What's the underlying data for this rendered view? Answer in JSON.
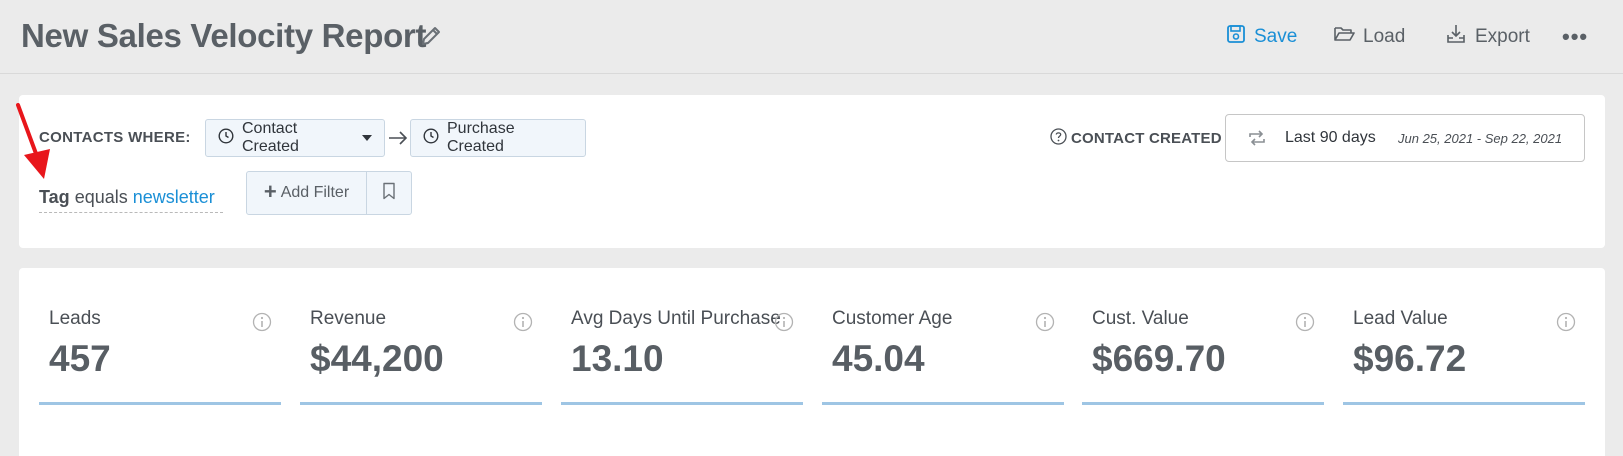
{
  "header": {
    "title": "New Sales Velocity Report",
    "save_label": "Save",
    "load_label": "Load",
    "export_label": "Export",
    "more_label": "•••"
  },
  "filters": {
    "contacts_where_label": "CONTACTS WHERE:",
    "step1_label": "Contact Created",
    "step2_label": "Purchase Created",
    "date_field_label": "CONTACT CREATED",
    "date_range_label": "Last 90 days",
    "date_range_dates": "Jun 25, 2021 - Sep 22, 2021",
    "tag_filter": {
      "key": "Tag",
      "operator": "equals",
      "value": "newsletter"
    },
    "add_filter_label": "Add Filter"
  },
  "metrics": [
    {
      "label": "Leads",
      "value": "457"
    },
    {
      "label": "Revenue",
      "value": "$44,200"
    },
    {
      "label": "Avg Days Until Purchase",
      "value": "13.10"
    },
    {
      "label": "Customer Age",
      "value": "45.04"
    },
    {
      "label": "Cust. Value",
      "value": "$669.70"
    },
    {
      "label": "Lead Value",
      "value": "$96.72"
    }
  ],
  "colors": {
    "accent": "#1a8fd6",
    "metric_underline": "#9ec5e4",
    "annotation_arrow": "#e8161b"
  },
  "icons": {
    "title_edit": "pencil-icon",
    "save": "floppy-disk-icon",
    "load": "folder-open-icon",
    "export": "download-tray-icon",
    "steps": "clock-icon",
    "date_field_help": "question-circle-icon",
    "date_range": "repeat-icon",
    "bookmark": "bookmark-icon",
    "metric_info": "info-circle-icon"
  }
}
